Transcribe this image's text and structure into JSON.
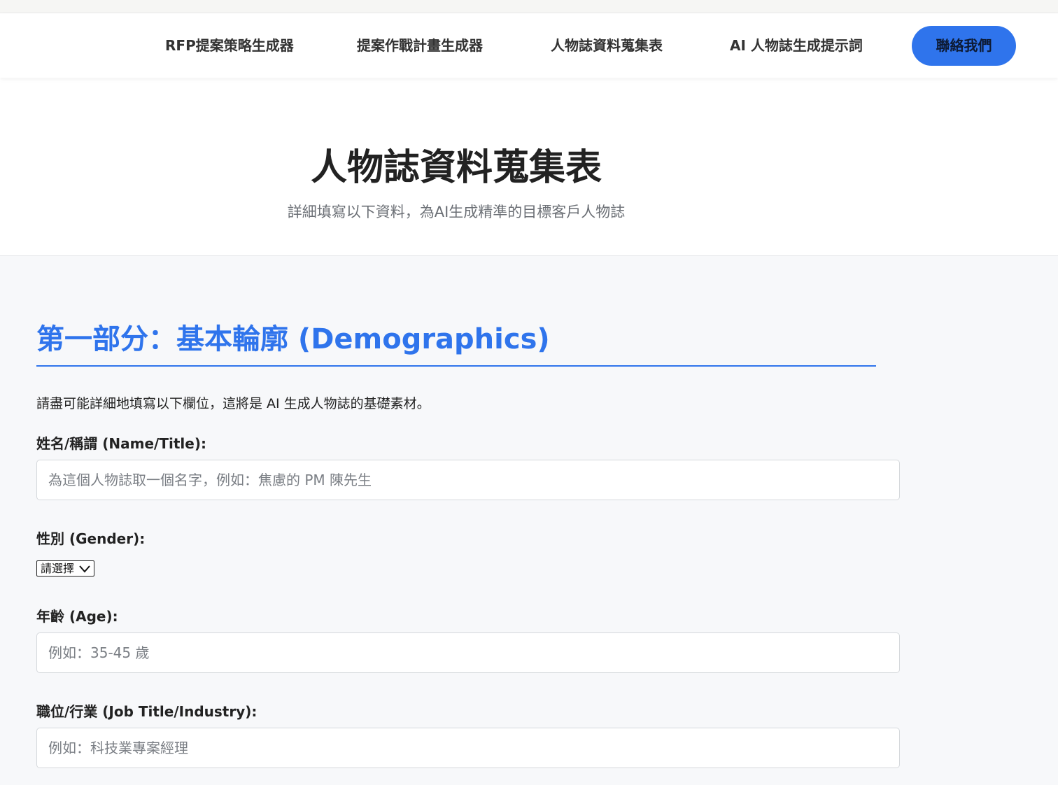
{
  "nav": {
    "links": [
      {
        "label": "RFP提案策略生成器"
      },
      {
        "label": "提案作戰計畫生成器"
      },
      {
        "label": "人物誌資料蒐集表"
      },
      {
        "label": "AI 人物誌生成提示詞"
      }
    ],
    "cta_label": "聯絡我們"
  },
  "hero": {
    "title": "人物誌資料蒐集表",
    "subtitle": "詳細填寫以下資料，為AI生成精準的目標客戶人物誌"
  },
  "section1": {
    "title": "第一部分：基本輪廓 (Demographics)",
    "intro": "請盡可能詳細地填寫以下欄位，這將是 AI 生成人物誌的基礎素材。",
    "fields": {
      "name": {
        "label": "姓名/稱謂 (Name/Title):",
        "placeholder": "為這個人物誌取一個名字，例如：焦慮的 PM 陳先生"
      },
      "gender": {
        "label": "性別 (Gender):",
        "selected": "請選擇"
      },
      "age": {
        "label": "年齡 (Age):",
        "placeholder": "例如：35-45 歲"
      },
      "job": {
        "label": "職位/行業 (Job Title/Industry):",
        "placeholder": "例如：科技業專案經理"
      }
    }
  },
  "colors": {
    "accent": "#2f74ec",
    "background": "#f7f8fa"
  }
}
